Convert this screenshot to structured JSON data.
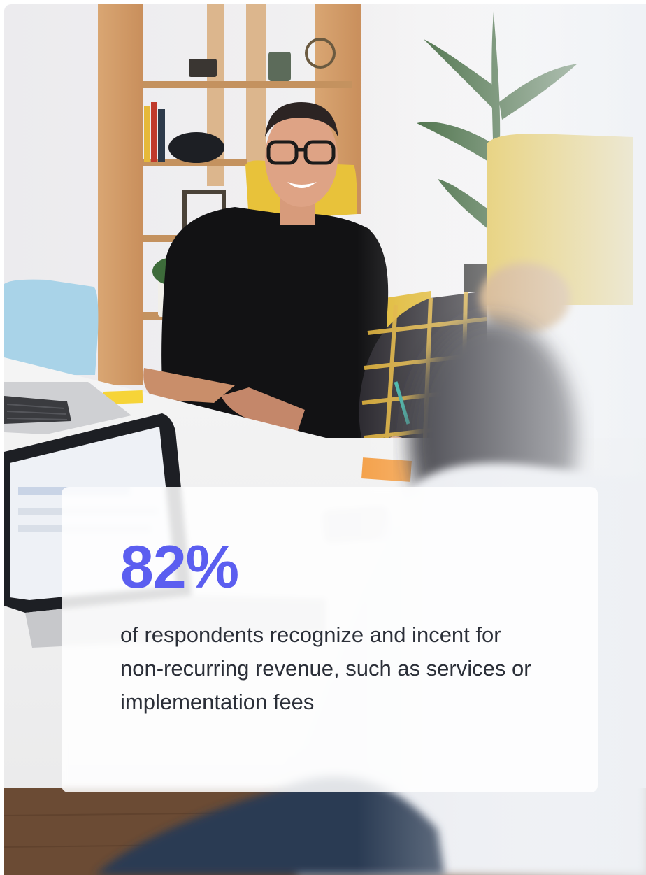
{
  "stat_card": {
    "value": "82%",
    "description": "of respondents recognize and incent for non-recurring revenue, such as services or implementation fees"
  },
  "colors": {
    "accent": "#5b5ef0",
    "text": "#2b2f38",
    "card_background": "#ffffff"
  }
}
